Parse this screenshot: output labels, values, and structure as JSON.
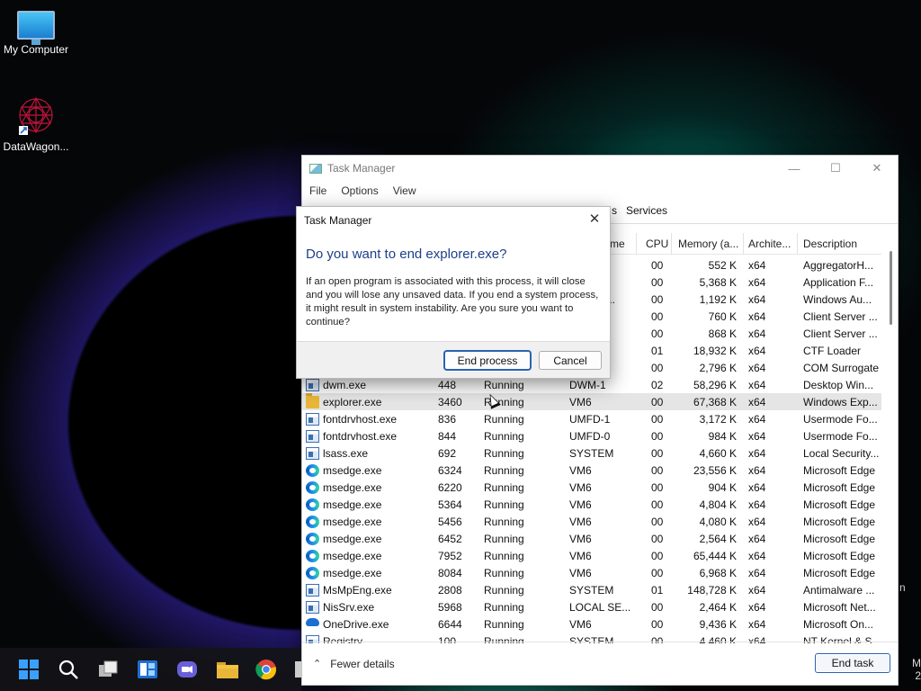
{
  "desktop": {
    "icons": [
      {
        "label": "My Computer",
        "icon": "monitor-icon"
      },
      {
        "label": "DataWagon...",
        "icon": "datawagon-shortcut-icon"
      }
    ],
    "tray_fragment": "M\n2",
    "side_fragment": "n"
  },
  "task_manager": {
    "title": "Task Manager",
    "window_controls": {
      "minimize": "—",
      "maximize": "☐",
      "close": "✕"
    },
    "menu": [
      "File",
      "Options",
      "View"
    ],
    "tabs_visible": [
      "s",
      "Services"
    ],
    "columns": [
      "me",
      "CPU",
      "Memory (a...",
      "Archite...",
      "Description"
    ],
    "partial_rows": [
      {
        "cpu": "00",
        "memory": "552 K",
        "arch": "x64",
        "description": "AggregatorH..."
      },
      {
        "cpu": "00",
        "memory": "5,368 K",
        "arch": "x64",
        "description": "Application F..."
      },
      {
        "user": "E...",
        "cpu": "00",
        "memory": "1,192 K",
        "arch": "x64",
        "description": "Windows Au..."
      },
      {
        "cpu": "00",
        "memory": "760 K",
        "arch": "x64",
        "description": "Client Server ..."
      },
      {
        "cpu": "00",
        "memory": "868 K",
        "arch": "x64",
        "description": "Client Server ..."
      },
      {
        "cpu": "01",
        "memory": "18,932 K",
        "arch": "x64",
        "description": "CTF Loader"
      },
      {
        "cpu": "00",
        "memory": "2,796 K",
        "arch": "x64",
        "description": "COM Surrogate"
      }
    ],
    "rows": [
      {
        "name": "dwm.exe",
        "icon": "window-icon",
        "pid": "448",
        "status": "Running",
        "user": "DWM-1",
        "cpu": "02",
        "memory": "58,296 K",
        "arch": "x64",
        "description": "Desktop Win..."
      },
      {
        "name": "explorer.exe",
        "icon": "folder-icon",
        "pid": "3460",
        "status": "Running",
        "user": "VM6",
        "cpu": "00",
        "memory": "67,368 K",
        "arch": "x64",
        "description": "Windows Exp...",
        "selected": true
      },
      {
        "name": "fontdrvhost.exe",
        "icon": "window-icon",
        "pid": "836",
        "status": "Running",
        "user": "UMFD-1",
        "cpu": "00",
        "memory": "3,172 K",
        "arch": "x64",
        "description": "Usermode Fo..."
      },
      {
        "name": "fontdrvhost.exe",
        "icon": "window-icon",
        "pid": "844",
        "status": "Running",
        "user": "UMFD-0",
        "cpu": "00",
        "memory": "984 K",
        "arch": "x64",
        "description": "Usermode Fo..."
      },
      {
        "name": "lsass.exe",
        "icon": "window-icon",
        "pid": "692",
        "status": "Running",
        "user": "SYSTEM",
        "cpu": "00",
        "memory": "4,660 K",
        "arch": "x64",
        "description": "Local Security..."
      },
      {
        "name": "msedge.exe",
        "icon": "edge-icon",
        "pid": "6324",
        "status": "Running",
        "user": "VM6",
        "cpu": "00",
        "memory": "23,556 K",
        "arch": "x64",
        "description": "Microsoft Edge"
      },
      {
        "name": "msedge.exe",
        "icon": "edge-icon",
        "pid": "6220",
        "status": "Running",
        "user": "VM6",
        "cpu": "00",
        "memory": "904 K",
        "arch": "x64",
        "description": "Microsoft Edge"
      },
      {
        "name": "msedge.exe",
        "icon": "edge-icon",
        "pid": "5364",
        "status": "Running",
        "user": "VM6",
        "cpu": "00",
        "memory": "4,804 K",
        "arch": "x64",
        "description": "Microsoft Edge"
      },
      {
        "name": "msedge.exe",
        "icon": "edge-icon",
        "pid": "5456",
        "status": "Running",
        "user": "VM6",
        "cpu": "00",
        "memory": "4,080 K",
        "arch": "x64",
        "description": "Microsoft Edge"
      },
      {
        "name": "msedge.exe",
        "icon": "edge-icon",
        "pid": "6452",
        "status": "Running",
        "user": "VM6",
        "cpu": "00",
        "memory": "2,564 K",
        "arch": "x64",
        "description": "Microsoft Edge"
      },
      {
        "name": "msedge.exe",
        "icon": "edge-icon",
        "pid": "7952",
        "status": "Running",
        "user": "VM6",
        "cpu": "00",
        "memory": "65,444 K",
        "arch": "x64",
        "description": "Microsoft Edge"
      },
      {
        "name": "msedge.exe",
        "icon": "edge-icon",
        "pid": "8084",
        "status": "Running",
        "user": "VM6",
        "cpu": "00",
        "memory": "6,968 K",
        "arch": "x64",
        "description": "Microsoft Edge"
      },
      {
        "name": "MsMpEng.exe",
        "icon": "window-icon",
        "pid": "2808",
        "status": "Running",
        "user": "SYSTEM",
        "cpu": "01",
        "memory": "148,728 K",
        "arch": "x64",
        "description": "Antimalware ..."
      },
      {
        "name": "NisSrv.exe",
        "icon": "window-icon",
        "pid": "5968",
        "status": "Running",
        "user": "LOCAL SE...",
        "cpu": "00",
        "memory": "2,464 K",
        "arch": "x64",
        "description": "Microsoft Net..."
      },
      {
        "name": "OneDrive.exe",
        "icon": "onedrive-icon",
        "pid": "6644",
        "status": "Running",
        "user": "VM6",
        "cpu": "00",
        "memory": "9,436 K",
        "arch": "x64",
        "description": "Microsoft On..."
      },
      {
        "name": "Registry",
        "icon": "window-icon",
        "pid": "100",
        "status": "Running",
        "user": "SYSTEM",
        "cpu": "00",
        "memory": "4,460 K",
        "arch": "x64",
        "description": "NT Kernel & S..."
      }
    ],
    "footer": {
      "fewer_details": "Fewer details",
      "end_task": "End task"
    }
  },
  "dialog": {
    "title": "Task Manager",
    "close": "✕",
    "heading": "Do you want to end explorer.exe?",
    "body": "If an open program is associated with this process, it will close and you will lose any unsaved data. If you end a system process, it might result in system instability. Are you sure you want to continue?",
    "primary_button": "End process",
    "cancel_button": "Cancel"
  },
  "taskbar": {
    "icons": [
      "start-icon",
      "search-icon",
      "task-view-icon",
      "widgets-icon",
      "chat-icon",
      "file-explorer-icon",
      "chrome-icon",
      "task-manager-icon"
    ]
  }
}
